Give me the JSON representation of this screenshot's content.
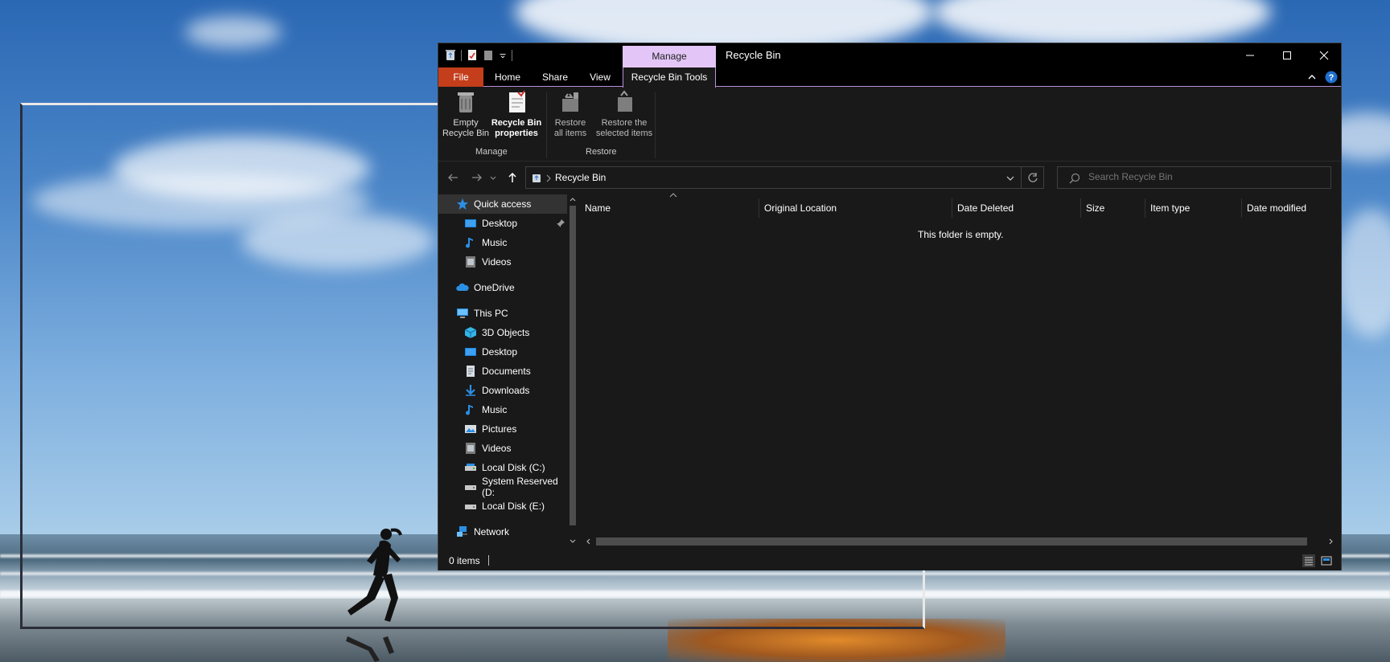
{
  "window": {
    "title": "Recycle Bin",
    "context_tab": "Manage",
    "tabs": {
      "file": "File",
      "home": "Home",
      "share": "Share",
      "view": "View",
      "tools": "Recycle Bin Tools"
    }
  },
  "ribbon": {
    "empty_recycle_bin": {
      "line1": "Empty",
      "line2": "Recycle Bin"
    },
    "properties": {
      "line1": "Recycle Bin",
      "line2": "properties"
    },
    "restore_all": {
      "line1": "Restore",
      "line2": "all items"
    },
    "restore_selected": {
      "line1": "Restore the",
      "line2": "selected items"
    },
    "group_manage": "Manage",
    "group_restore": "Restore"
  },
  "address": {
    "crumb": "Recycle Bin",
    "search_placeholder": "Search Recycle Bin"
  },
  "nav": {
    "items": [
      {
        "label": "Quick access",
        "icon": "star-icon"
      },
      {
        "label": "Desktop",
        "icon": "desktop-icon",
        "pinned": true
      },
      {
        "label": "Music",
        "icon": "music-icon"
      },
      {
        "label": "Videos",
        "icon": "videos-icon"
      },
      {
        "label": "OneDrive",
        "icon": "cloud-icon"
      },
      {
        "label": "This PC",
        "icon": "computer-icon"
      },
      {
        "label": "3D Objects",
        "icon": "cube-icon"
      },
      {
        "label": "Desktop",
        "icon": "desktop-icon"
      },
      {
        "label": "Documents",
        "icon": "document-icon"
      },
      {
        "label": "Downloads",
        "icon": "download-icon"
      },
      {
        "label": "Music",
        "icon": "music-icon"
      },
      {
        "label": "Pictures",
        "icon": "pictures-icon"
      },
      {
        "label": "Videos",
        "icon": "videos-icon"
      },
      {
        "label": "Local Disk (C:)",
        "icon": "drive-icon"
      },
      {
        "label": "System Reserved (D:",
        "icon": "drive-icon"
      },
      {
        "label": "Local Disk (E:)",
        "icon": "drive-icon"
      },
      {
        "label": "Network",
        "icon": "network-icon"
      }
    ]
  },
  "columns": [
    "Name",
    "Original Location",
    "Date Deleted",
    "Size",
    "Item type",
    "Date modified"
  ],
  "empty_message": "This folder is empty.",
  "status": {
    "count": "0 items"
  },
  "colors": {
    "accent_purple": "#e3c6f7",
    "file_tab": "#c43e1c",
    "window_bg": "#191919",
    "titlebar": "#000000"
  }
}
